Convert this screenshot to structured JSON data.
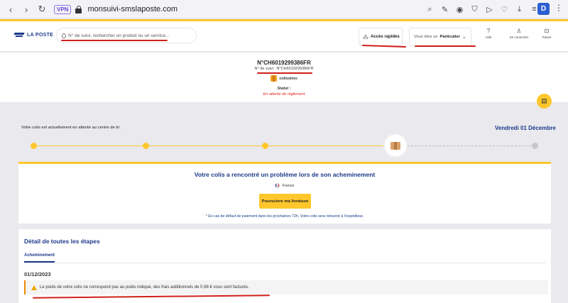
{
  "browser": {
    "url": "monsuivi-smslaposte.com",
    "vpn_label": "VPN",
    "profile_initial": "D"
  },
  "header": {
    "logo_text": "LA POSTE",
    "search_placeholder": "N° de suivi, rechercher un produit ou un service...",
    "quick_access_label": "Accès rapides",
    "user_type_prefix": "Vous êtes un",
    "user_type_value": "Particulier",
    "help_label": "Aide",
    "login_label": "Se connecter",
    "cart_label": "Panier"
  },
  "tracking": {
    "title": "N°CH6019299386FR",
    "subtitle": "N° de suivi : N°CH6019299386FR",
    "carrier": "colissimo",
    "status_label": "Statut :",
    "status_value": "En attente de règlement"
  },
  "progress": {
    "message": "Votre colis est actuellement en attente au centre de tri.",
    "date": "Vendredi 01 Décembre"
  },
  "problem": {
    "title": "Votre colis a rencontré un problème lors de son acheminement",
    "country": "France",
    "button_label": "Poursuivre ma livraison",
    "note": "* En cas de défaut de paiement dans les prochaines 72h, Votre colis sera retourné à l'expéditeur."
  },
  "steps": {
    "title": "Détail de toutes les étapes",
    "tab_label": "Acheminement",
    "date": "01/12/2023",
    "message": "Le poids de votre colis ne correspond pas au poids indiqué, des frais additionnels de 0,98 € vous sont facturés."
  },
  "colors": {
    "accent_yellow": "#ffc72c",
    "brand_blue": "#1d3a8a",
    "alert_red": "#e0261b",
    "annotation_red": "#d0201a"
  }
}
